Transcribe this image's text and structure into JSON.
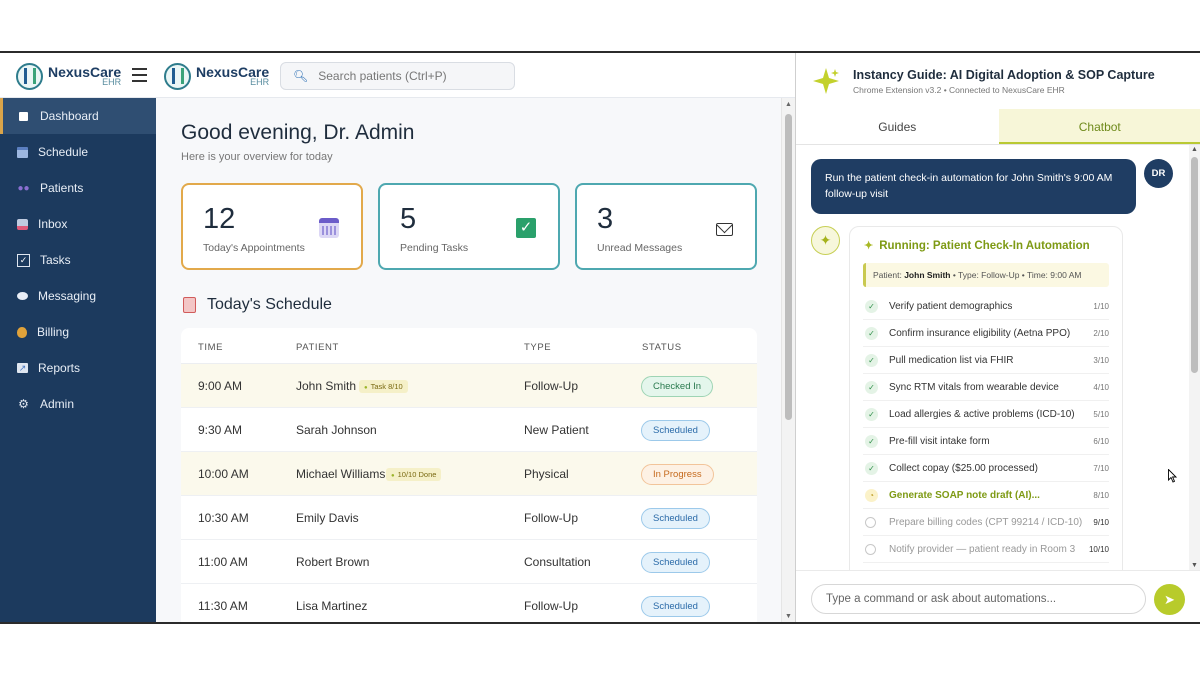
{
  "ehr": {
    "brand_name": "NexusCare",
    "brand_sub": "EHR",
    "search_placeholder": "Search patients (Ctrl+P)",
    "sidebar": [
      {
        "label": "Dashboard",
        "icon": "dashboard-icon",
        "active": true
      },
      {
        "label": "Schedule",
        "icon": "calendar-icon"
      },
      {
        "label": "Patients",
        "icon": "patients-icon"
      },
      {
        "label": "Inbox",
        "icon": "inbox-icon"
      },
      {
        "label": "Tasks",
        "icon": "checkbox-icon"
      },
      {
        "label": "Messaging",
        "icon": "chat-bubble-icon"
      },
      {
        "label": "Billing",
        "icon": "money-bag-icon"
      },
      {
        "label": "Reports",
        "icon": "chart-icon"
      },
      {
        "label": "Admin",
        "icon": "gear-icon"
      }
    ],
    "greeting": "Good evening, Dr. Admin",
    "greeting_sub": "Here is your overview for today",
    "cards": [
      {
        "value": "12",
        "label": "Today's Appointments",
        "icon": "calendar-icon"
      },
      {
        "value": "5",
        "label": "Pending Tasks",
        "icon": "checkmark-icon"
      },
      {
        "value": "3",
        "label": "Unread Messages",
        "icon": "envelope-icon"
      }
    ],
    "schedule_title": "Today's Schedule",
    "columns": [
      "TIME",
      "PATIENT",
      "TYPE",
      "STATUS"
    ],
    "rows": [
      {
        "time": "9:00 AM",
        "patient": "John Smith",
        "tag": "Task 8/10",
        "type": "Follow-Up",
        "status": "Checked In"
      },
      {
        "time": "9:30 AM",
        "patient": "Sarah Johnson",
        "tag": "",
        "type": "New Patient",
        "status": "Scheduled"
      },
      {
        "time": "10:00 AM",
        "patient": "Michael Williams",
        "tag": "10/10 Done",
        "type": "Physical",
        "status": "In Progress"
      },
      {
        "time": "10:30 AM",
        "patient": "Emily Davis",
        "tag": "",
        "type": "Follow-Up",
        "status": "Scheduled"
      },
      {
        "time": "11:00 AM",
        "patient": "Robert Brown",
        "tag": "",
        "type": "Consultation",
        "status": "Scheduled"
      },
      {
        "time": "11:30 AM",
        "patient": "Lisa Martinez",
        "tag": "",
        "type": "Follow-Up",
        "status": "Scheduled"
      }
    ]
  },
  "extension": {
    "title": "Instancy Guide: AI Digital Adoption & SOP Capture",
    "subtitle": "Chrome Extension v3.2 • Connected to NexusCare EHR",
    "tabs": [
      "Guides",
      "Chatbot"
    ],
    "active_tab": "Chatbot",
    "user_message": "Run the patient check-in automation for John Smith's 9:00 AM follow-up visit",
    "user_initials": "DR",
    "run_title": "Running: Patient Check-In Automation",
    "context": {
      "patient_label": "Patient:",
      "patient": "John Smith",
      "rest": " • Type: Follow-Up • Time: 9:00 AM"
    },
    "steps": [
      {
        "label": "Verify patient demographics",
        "num": "1/10",
        "state": "done"
      },
      {
        "label": "Confirm insurance eligibility (Aetna PPO)",
        "num": "2/10",
        "state": "done"
      },
      {
        "label": "Pull medication list via FHIR",
        "num": "3/10",
        "state": "done"
      },
      {
        "label": "Sync RTM vitals from wearable device",
        "num": "4/10",
        "state": "done"
      },
      {
        "label": "Load allergies & active problems (ICD-10)",
        "num": "5/10",
        "state": "done"
      },
      {
        "label": "Pre-fill visit intake form",
        "num": "6/10",
        "state": "done"
      },
      {
        "label": "Collect copay ($25.00 processed)",
        "num": "7/10",
        "state": "done"
      },
      {
        "label": "Generate SOAP note draft (AI)...",
        "num": "8/10",
        "state": "running"
      },
      {
        "label": "Prepare billing codes (CPT 99214 / ICD-10)",
        "num": "9/10",
        "state": "pending"
      },
      {
        "label": "Notify provider — patient ready in Room 3",
        "num": "10/10",
        "state": "pending"
      }
    ],
    "input_placeholder": "Type a command or ask about automations..."
  }
}
